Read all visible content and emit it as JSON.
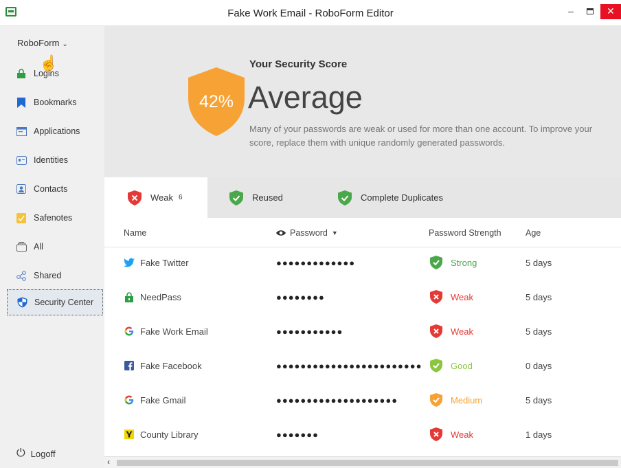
{
  "window": {
    "title": "Fake Work Email - RoboForm Editor",
    "minimize_glyph": "–",
    "close_glyph": "✕"
  },
  "sidebar": {
    "brand": "RoboForm",
    "items": [
      {
        "label": "Logins",
        "icon": "lock-icon"
      },
      {
        "label": "Bookmarks",
        "icon": "bookmark-icon"
      },
      {
        "label": "Applications",
        "icon": "application-icon"
      },
      {
        "label": "Identities",
        "icon": "identity-card-icon"
      },
      {
        "label": "Contacts",
        "icon": "contact-icon"
      },
      {
        "label": "Safenotes",
        "icon": "note-icon"
      },
      {
        "label": "All",
        "icon": "stack-icon"
      },
      {
        "label": "Shared",
        "icon": "share-icon"
      },
      {
        "label": "Security Center",
        "icon": "shield-icon",
        "active": true
      }
    ],
    "logoff": "Logoff"
  },
  "security": {
    "percent_text": "42%",
    "percent": 42,
    "label": "Your Security Score",
    "rating": "Average",
    "description": "Many of your passwords are weak or used for more than one account. To improve your score, replace them with unique randomly generated passwords.",
    "shield_color": "#f7a234"
  },
  "tabs": [
    {
      "label": "Weak",
      "count": "6",
      "status": "weak"
    },
    {
      "label": "Reused",
      "status": "ok"
    },
    {
      "label": "Complete Duplicates",
      "status": "ok"
    }
  ],
  "table": {
    "headers": {
      "name": "Name",
      "password": "Password",
      "strength": "Password Strength",
      "age": "Age"
    },
    "rows": [
      {
        "name": "Fake Twitter",
        "icon": "twitter-icon",
        "password": "●●●●●●●●●●●●●",
        "strength": "Strong",
        "level": "strong",
        "age": "5 days"
      },
      {
        "name": "NeedPass",
        "icon": "lock-icon",
        "password": "●●●●●●●●",
        "strength": "Weak",
        "level": "weak",
        "age": "5 days"
      },
      {
        "name": "Fake Work Email",
        "icon": "google-icon",
        "password": "●●●●●●●●●●●",
        "strength": "Weak",
        "level": "weak",
        "age": "5 days"
      },
      {
        "name": "Fake Facebook",
        "icon": "facebook-icon",
        "password": "●●●●●●●●●●●●●●●●●●●●●●●●",
        "strength": "Good",
        "level": "good",
        "age": "0 days"
      },
      {
        "name": "Fake Gmail",
        "icon": "google-icon",
        "password": "●●●●●●●●●●●●●●●●●●●●",
        "strength": "Medium",
        "level": "medium",
        "age": "5 days"
      },
      {
        "name": "County Library",
        "icon": "yahoo-icon",
        "password": "●●●●●●●",
        "strength": "Weak",
        "level": "weak",
        "age": "1 days"
      }
    ]
  },
  "colors": {
    "strong": "#4aa74a",
    "good": "#8cc63f",
    "medium": "#f7a234",
    "weak": "#e53935"
  }
}
